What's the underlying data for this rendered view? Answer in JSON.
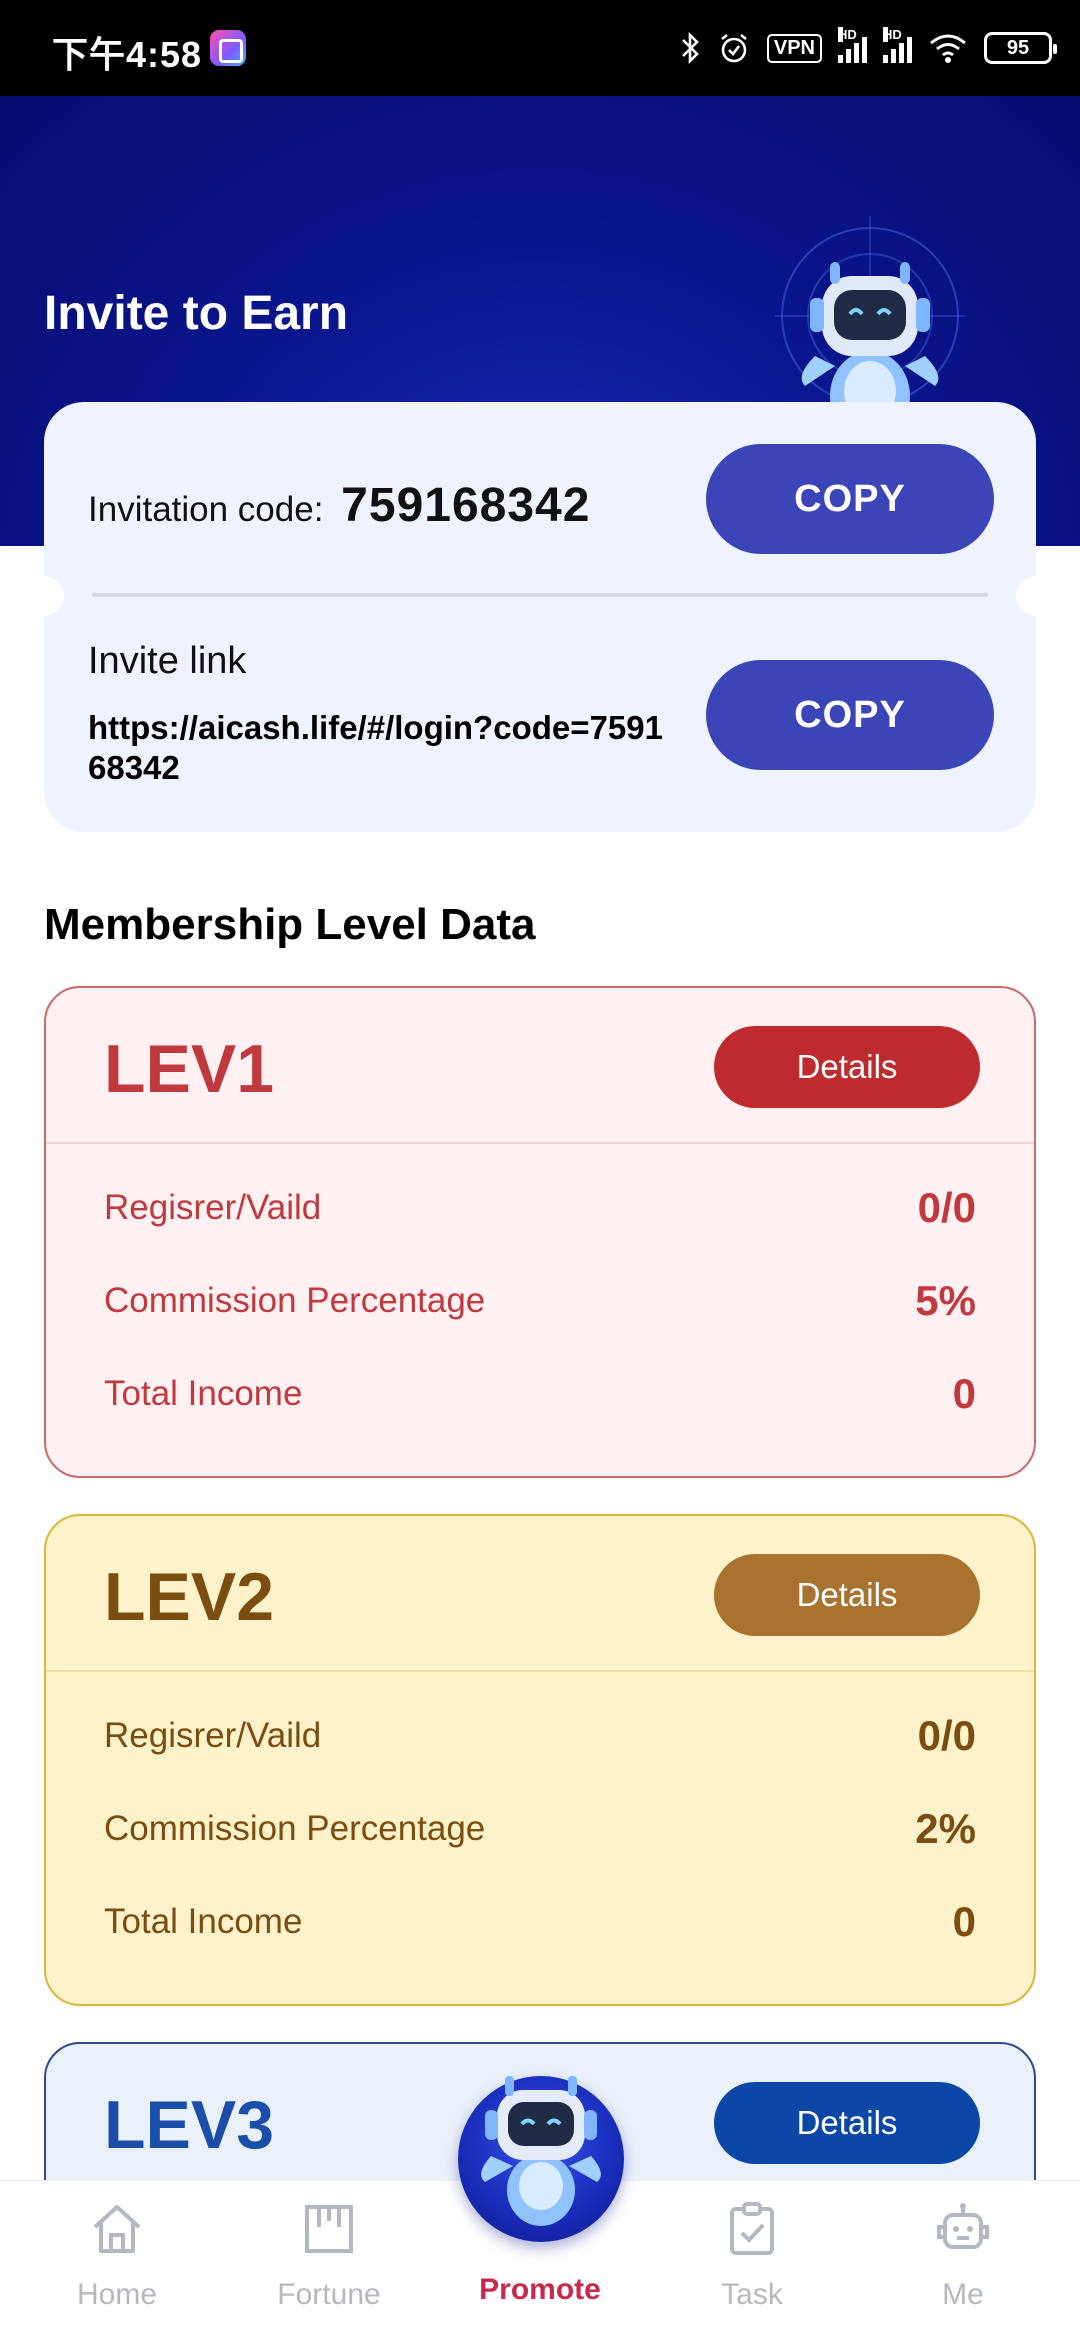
{
  "status_bar": {
    "time": "下午4:58",
    "vpn": "VPN",
    "hd": "HD",
    "battery": "95"
  },
  "header": {
    "title": "Invite to Earn"
  },
  "invite": {
    "code_label": "Invitation code:",
    "code": "759168342",
    "copy_code_label": "COPY",
    "link_label": "Invite link",
    "link": "https://aicash.life/#/login?code=759168342",
    "copy_link_label": "COPY"
  },
  "membership": {
    "title": "Membership Level Data",
    "levels": [
      {
        "name": "LEV1",
        "details_label": "Details",
        "rows": [
          {
            "label": "Regisrer/Vaild",
            "value": "0/0"
          },
          {
            "label": "Commission Percentage",
            "value": "5%"
          },
          {
            "label": "Total Income",
            "value": "0"
          }
        ]
      },
      {
        "name": "LEV2",
        "details_label": "Details",
        "rows": [
          {
            "label": "Regisrer/Vaild",
            "value": "0/0"
          },
          {
            "label": "Commission Percentage",
            "value": "2%"
          },
          {
            "label": "Total Income",
            "value": "0"
          }
        ]
      },
      {
        "name": "LEV3",
        "details_label": "Details"
      }
    ]
  },
  "nav": {
    "items": [
      {
        "label": "Home",
        "icon": "home-icon"
      },
      {
        "label": "Fortune",
        "icon": "fortune-icon"
      },
      {
        "label": "Promote",
        "icon": "robot-icon",
        "active": true
      },
      {
        "label": "Task",
        "icon": "task-clipboard-icon"
      },
      {
        "label": "Me",
        "icon": "robot-me-icon"
      }
    ]
  },
  "colors": {
    "hero_bg": "#0b1690",
    "copy_button": "#3b45b8",
    "lev1_accent": "#c0393f",
    "lev2_accent": "#7a4d10",
    "lev3_accent": "#1b4ea8",
    "nav_active": "#c8284a"
  }
}
